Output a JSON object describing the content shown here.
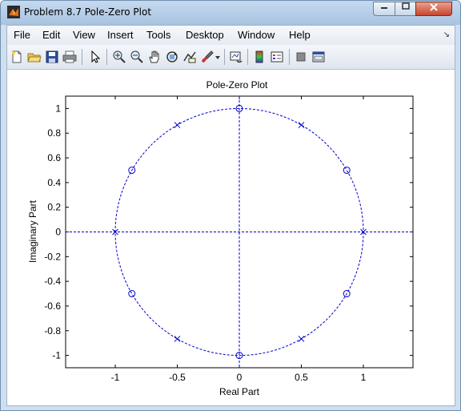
{
  "window": {
    "title": "Problem 8.7 Pole-Zero Plot"
  },
  "menu": [
    "File",
    "Edit",
    "View",
    "Insert",
    "Tools",
    "Desktop",
    "Window",
    "Help"
  ],
  "toolbar": [
    "new-figure-icon",
    "open-icon",
    "save-icon",
    "print-icon",
    "pointer-icon",
    "zoom-in-icon",
    "zoom-out-icon",
    "pan-icon",
    "rotate-icon",
    "data-cursor-icon",
    "brush-icon",
    "dropdown-arrow-icon",
    "link-plot-icon",
    "colorbar-icon",
    "legend-icon",
    "hide-plot-tools-icon",
    "show-plot-tools-icon"
  ],
  "colors": {
    "series": "#0000cc",
    "titlebar": "#b9d1ea",
    "close": "#c8452f"
  },
  "chart_data": {
    "type": "scatter",
    "title": "Pole-Zero Plot",
    "xlabel": "Real Part",
    "ylabel": "Imaginary Part",
    "xlim": [
      -1.4,
      1.4
    ],
    "ylim": [
      -1.1,
      1.1
    ],
    "xticks": [
      -1,
      -0.5,
      0,
      0.5,
      1
    ],
    "xtick_labels": [
      "-1",
      "-0.5",
      "0",
      "0.5",
      "1"
    ],
    "yticks": [
      1,
      0.8,
      0.6,
      0.4,
      0.2,
      0,
      -0.2,
      -0.4,
      -0.6,
      -0.8,
      -1
    ],
    "ytick_labels": [
      "1",
      "0.8",
      "0.6",
      "0.4",
      "0.2",
      "0",
      "-0.2",
      "-0.4",
      "-0.6",
      "-0.8",
      "-1"
    ],
    "grid": false,
    "unit_circle": true,
    "zeros": [
      [
        0,
        1
      ],
      [
        0.866,
        0.5
      ],
      [
        0.866,
        -0.5
      ],
      [
        0,
        -1
      ],
      [
        -0.866,
        -0.5
      ],
      [
        -0.866,
        0.5
      ]
    ],
    "poles": [
      [
        1,
        0
      ],
      [
        0.5,
        0.866
      ],
      [
        -0.5,
        0.866
      ],
      [
        -1,
        0
      ],
      [
        -0.5,
        -0.866
      ],
      [
        0.5,
        -0.866
      ]
    ]
  }
}
